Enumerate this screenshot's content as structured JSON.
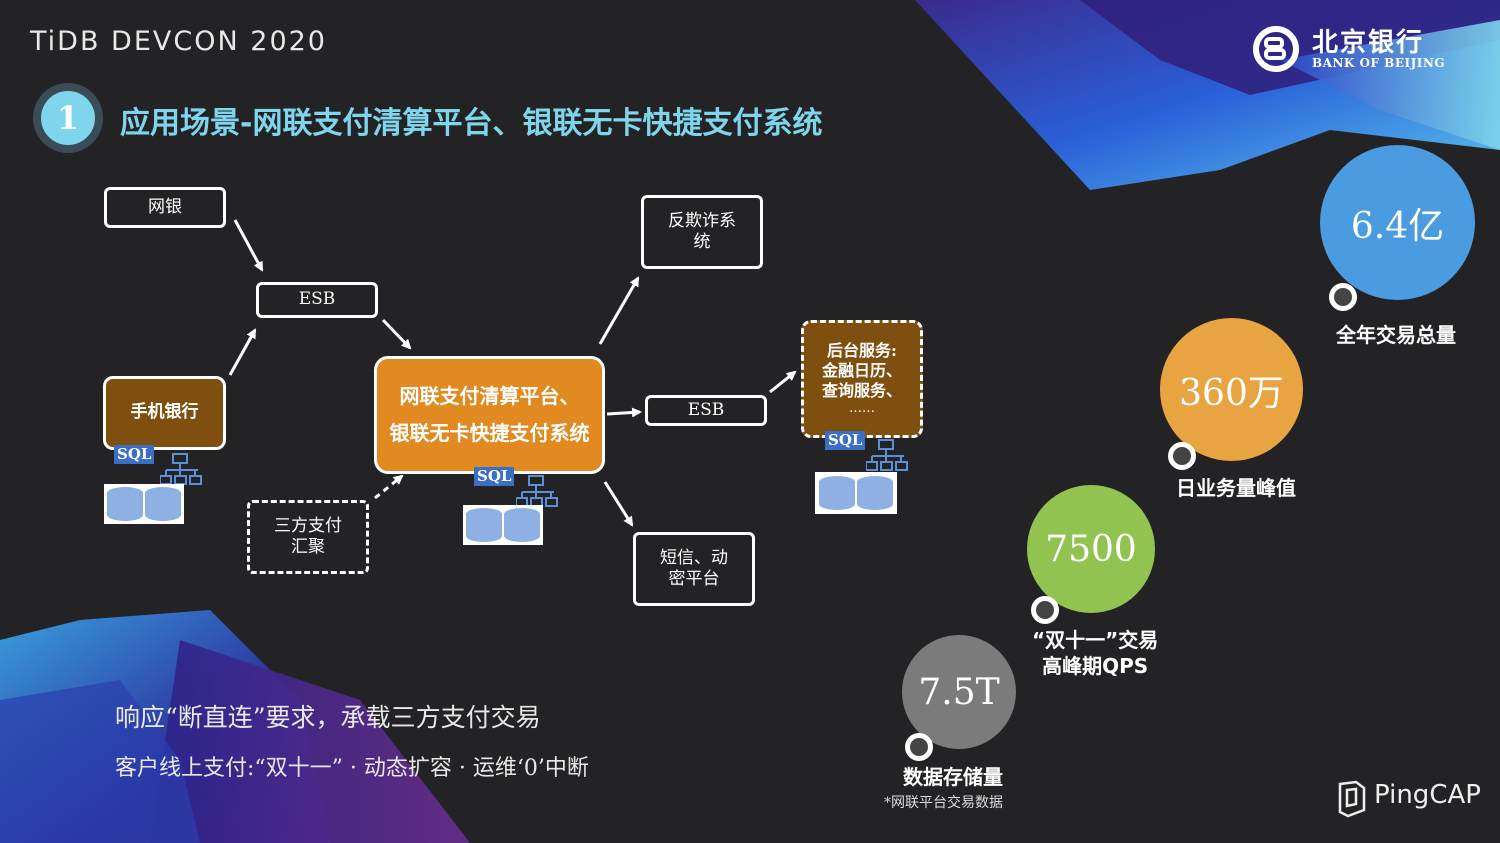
{
  "header": {
    "event_title": "TiDB DEVCON 2020",
    "bank_name_cn": "北京银行",
    "bank_name_en": "BANK OF BEIJING",
    "section_number": "1",
    "title": "应用场景-网联支付清算平台、银联无卡快捷支付系统"
  },
  "diagram": {
    "nodes": {
      "wangyin": "网银",
      "esb_top": "ESB",
      "mobile_bank": "手机银行",
      "third_party": "三方支付汇聚",
      "core_line1": "网联支付清算平台、",
      "core_line2": "银联无卡快捷支付系统",
      "anti_fraud": "反欺诈系统",
      "esb_right": "ESB",
      "sms": "短信、动密平台",
      "backend_line1": "后台服务:",
      "backend_line2": "金融日历、",
      "backend_line3": "查询服务、",
      "backend_line4": "……"
    },
    "sql_label": "SQL"
  },
  "stats": [
    {
      "value": "6.4亿",
      "label": "全年交易总量",
      "color": "#4a9be0"
    },
    {
      "value": "360万",
      "label": "日业务量峰值",
      "color": "#e8a440"
    },
    {
      "value": "7500",
      "label": "“双十一”交易",
      "label2": "高峰期QPS",
      "color": "#92c24f"
    },
    {
      "value": "7.5T",
      "label": "数据存储量",
      "color": "#7b7b7b"
    }
  ],
  "footer": {
    "line1": "响应“断直连”要求，承载三方支付交易",
    "line2": "客户线上支付:“双十一” · 动态扩容 · 运维‘0’中断",
    "note": "*网联平台交易数据",
    "brand": "PingCAP"
  }
}
